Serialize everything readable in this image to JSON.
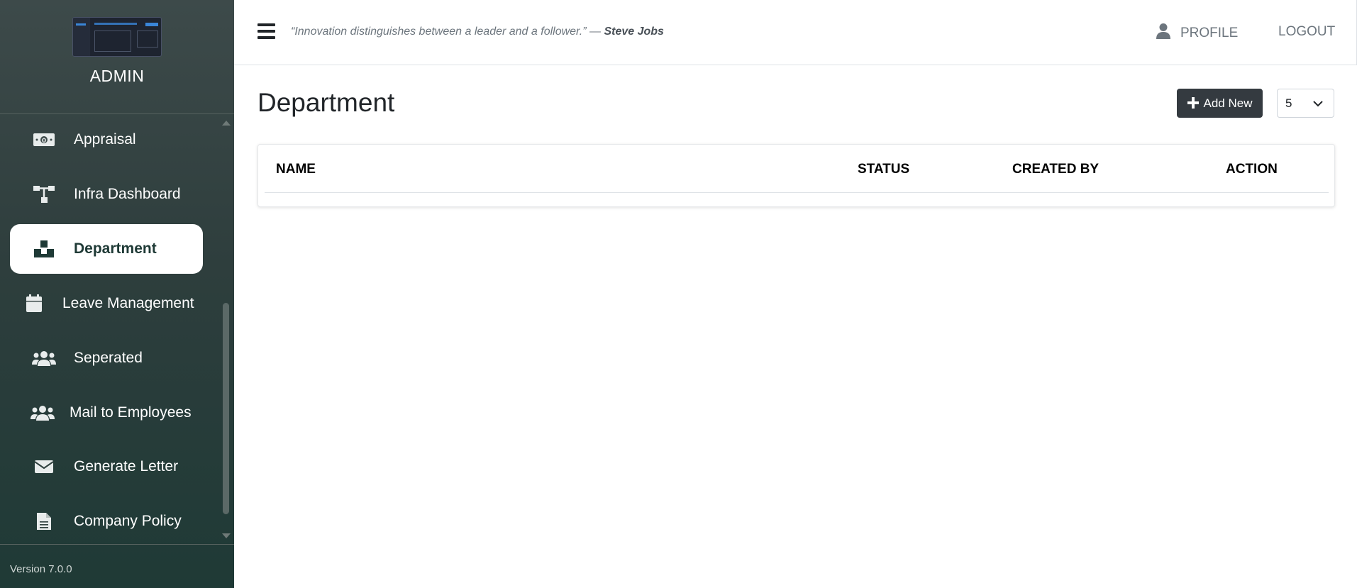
{
  "sidebar": {
    "brand_title": "ADMIN",
    "items": [
      {
        "label": "Appraisal",
        "icon": "money-bill-icon"
      },
      {
        "label": "Infra Dashboard",
        "icon": "sitemap-icon"
      },
      {
        "label": "Department",
        "icon": "cubes-icon",
        "active": true
      },
      {
        "label": "Leave Management",
        "icon": "calendar-icon"
      },
      {
        "label": "Seperated",
        "icon": "users-icon"
      },
      {
        "label": "Mail to Employees",
        "icon": "users-icon"
      },
      {
        "label": "Generate Letter",
        "icon": "envelope-icon"
      },
      {
        "label": "Company Policy",
        "icon": "file-icon"
      }
    ],
    "version": "Version 7.0.0"
  },
  "header": {
    "quote_text": "“Innovation distinguishes between a leader and a follower.” — ",
    "quote_author": "Steve Jobs",
    "profile_label": "PROFILE",
    "logout_label": "LOGOUT"
  },
  "main": {
    "title": "Department",
    "add_button_label": "Add New",
    "page_size": "5",
    "table": {
      "columns": [
        "NAME",
        "STATUS",
        "CREATED BY",
        "ACTION"
      ],
      "rows": []
    }
  },
  "colors": {
    "sidebar_top": "#3d4a4a",
    "sidebar_bottom": "#1f3a36",
    "button_dark": "#343a40"
  }
}
